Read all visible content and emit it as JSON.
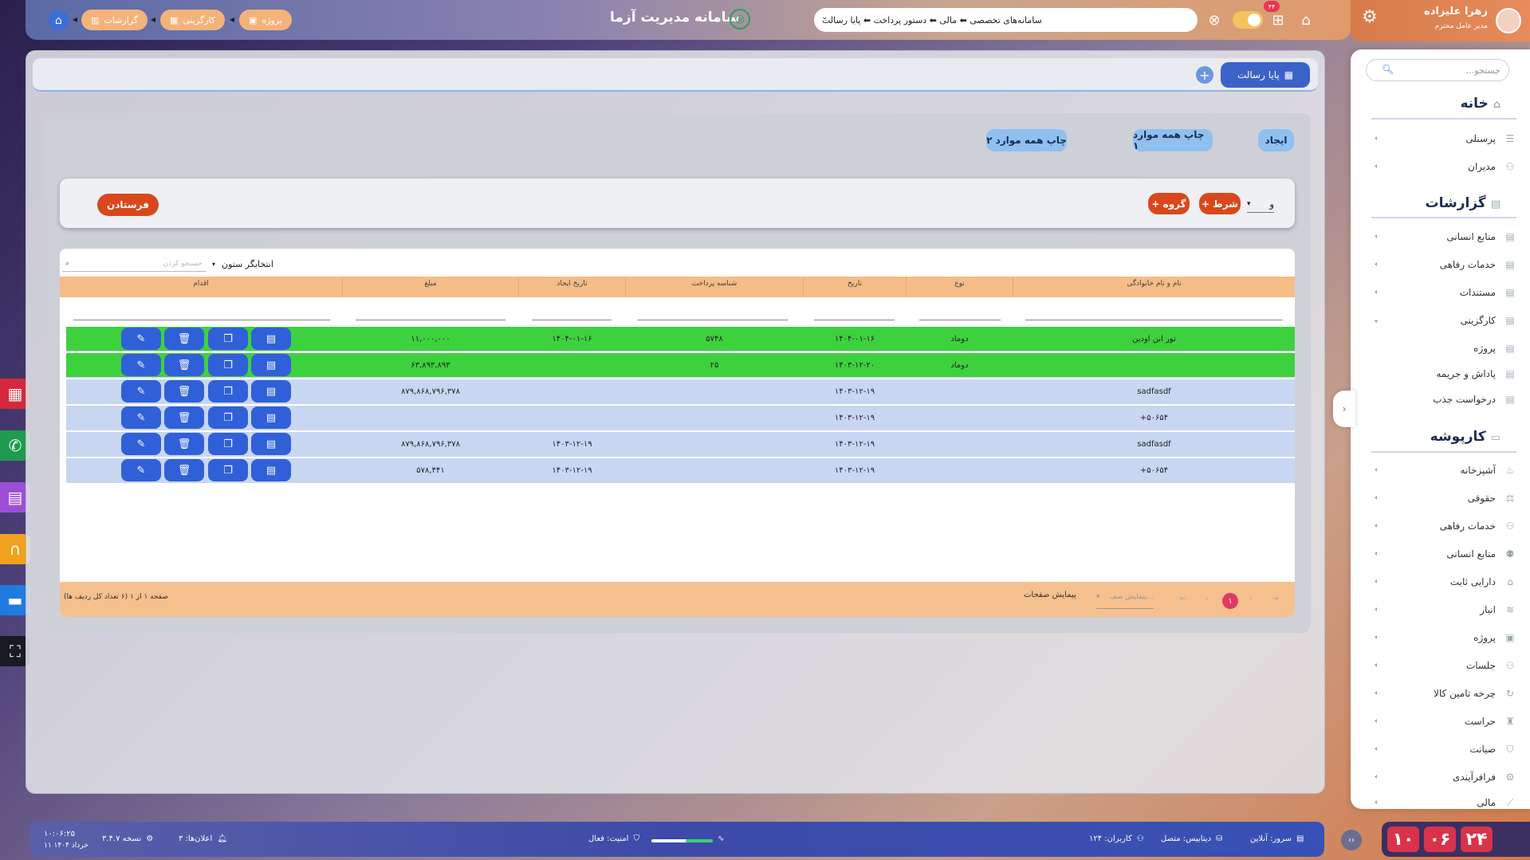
{
  "header": {
    "app_title": "سامانه مدیریت آزما",
    "breadcrumbs": [
      "پروژه",
      "کارگزینی",
      "گزارشات"
    ],
    "nav_path": "سامانه‌های تخصصی ⬅ مالی ⬅ دستور پرداخت ⬅ پایا رسالت",
    "notification_count": "۴۴"
  },
  "user": {
    "name": "زهرا علیزاده",
    "role": "مدیر عامل محترم"
  },
  "sidebar": {
    "search_placeholder": "جستجو...",
    "sections": [
      {
        "title": "خانه",
        "items": [
          "پرسنلی",
          "مدیران"
        ]
      },
      {
        "title": "گزارشات",
        "items": [
          "منابع انسانی",
          "خدمات رفاهی",
          "مستندات",
          "کارگزینی"
        ],
        "sub_items": [
          "پروژه",
          "پاداش و جریمه",
          "درخواست جذب"
        ]
      },
      {
        "title": "کارپوشه",
        "items": [
          "آشپزخانه",
          "حقوقی",
          "خدمات رفاهی",
          "منابع انسانی",
          "دارایی ثابت",
          "انبار",
          "پروژه",
          "جلسات",
          "چرخه تامین کالا",
          "حراست",
          "صیانت",
          "فرافرآیندی",
          "مالی"
        ]
      }
    ]
  },
  "tabs": {
    "active": "پایا رسالت"
  },
  "toolbar": {
    "create": "ایجاد",
    "print_all_1": "چاپ همه موارد ۱",
    "print_all_2": "چاپ همه موارد ۲"
  },
  "filter": {
    "operator": "و",
    "add_condition": "+ شرط",
    "add_group": "+ گروه",
    "send": "فرستادن"
  },
  "grid": {
    "column_chooser": "انتخابگر ستون",
    "search_placeholder": "جستجو کردن",
    "columns": [
      "نام و نام خانوادگی",
      "نوع",
      "تاریخ",
      "شناسه پرداخت",
      "تاریخ ایجاد",
      "مبلغ",
      "اقدام"
    ],
    "rows": [
      {
        "name": "تور ابن اودین",
        "type": "دوماد",
        "date": "۱۴۰۴-۰۱-۱۶",
        "payment_id": "۵۷۴۸",
        "created": "۱۴۰۴-۰۱-۱۶",
        "amount": "۱۱,۰۰۰,۰۰۰",
        "highlight": "green"
      },
      {
        "name": "",
        "type": "دوماد",
        "date": "۱۴۰۳-۱۲-۲۰",
        "payment_id": "۲۵",
        "created": "",
        "amount": "۶۳,۸۹۳,۸۹۳",
        "highlight": "green"
      },
      {
        "name": "sadfasdf",
        "type": "",
        "date": "۱۴۰۳-۱۲-۱۹",
        "payment_id": "",
        "created": "",
        "amount": "۸۷۹,۸۶۸,۷۹۶,۳۷۸",
        "highlight": "blue"
      },
      {
        "name": "+۵۰۶۵۴",
        "type": "",
        "date": "۱۴۰۳-۱۲-۱۹",
        "payment_id": "",
        "created": "",
        "amount": "",
        "highlight": "blue"
      },
      {
        "name": "sadfasdf",
        "type": "",
        "date": "۱۴۰۳-۱۲-۱۹",
        "payment_id": "",
        "created": "۱۴۰۳-۱۲-۱۹",
        "amount": "۸۷۹,۸۶۸,۷۹۶,۳۷۸",
        "highlight": "blue"
      },
      {
        "name": "+۵۰۶۵۴",
        "type": "",
        "date": "۱۴۰۳-۱۲-۱۹",
        "payment_id": "",
        "created": "۱۴۰۳-۱۲-۱۹",
        "amount": "۵۷۸,۴۴۱",
        "highlight": "blue"
      }
    ],
    "page_info": "صفحه ۱ از ۱ (۶ تعداد کل ردیف ها)",
    "page_size_label": "پیمایش صفحات",
    "page_size_placeholder": "پیمایش صف...",
    "current_page": "۱"
  },
  "status_bar": {
    "server": "سرور: آنلاین",
    "database": "دیتابیس: متصل",
    "users": "کاربران: ۱۲۴",
    "security": "امنیت: فعال",
    "version": "نسخه ۳.۴.۷",
    "notifications": "اعلان‌ها: ۳",
    "time": "۱۰:۰۶:۲۵",
    "date": "۱۱ خرداد ۱۴۰۴"
  },
  "clock": {
    "digits": [
      "۱۰",
      "۰۶",
      "۲۴"
    ]
  },
  "colors": {
    "accent": "#3b62c8",
    "orange": "#d8481c",
    "row_green": "#3ed13e",
    "row_blue": "#c8d6f2"
  }
}
